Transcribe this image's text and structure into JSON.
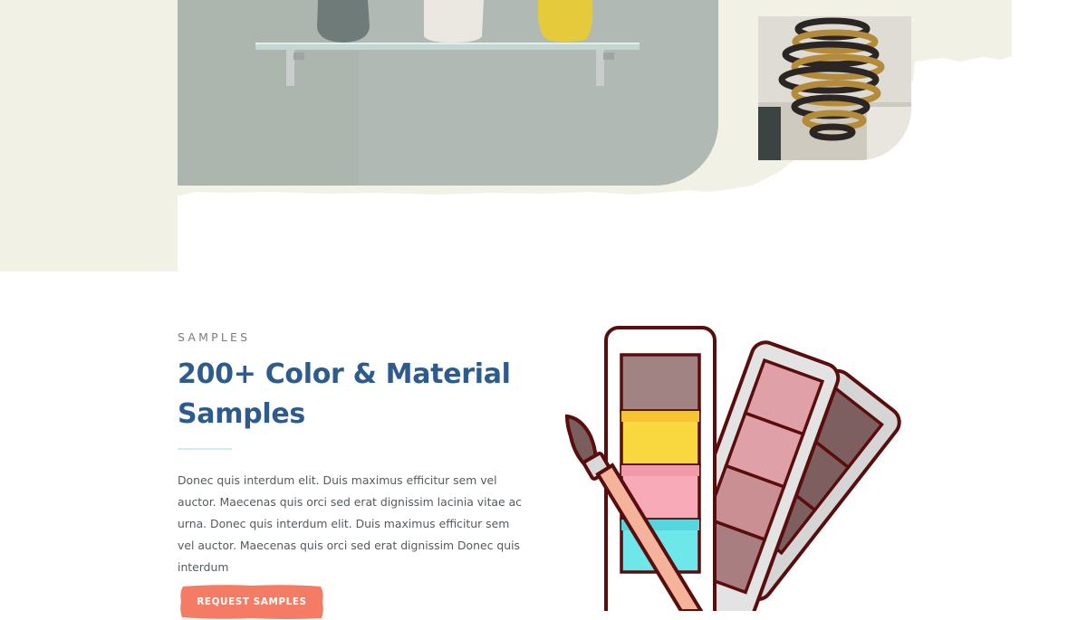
{
  "hero": {
    "photo_alt": "Glass shelf with vases",
    "chandelier_alt": "Spiral chandelier"
  },
  "samples": {
    "eyebrow": "SAMPLES",
    "heading": "200+ Color & Material Samples",
    "body": "Donec quis interdum elit. Duis maximus efficitur sem vel auctor. Maecenas quis orci sed erat dignissim lacinia vitae ac urna. Donec quis interdum elit. Duis maximus efficitur sem vel auctor. Maecenas quis orci sed erat dignissim Donec quis interdum",
    "cta_label": "REQUEST SAMPLES"
  },
  "colors": {
    "heading": "#2d5b8e",
    "cta": "#f47c64",
    "outline": "#5a0d0d"
  },
  "icons": {
    "swatch": "color-swatch-fan-icon",
    "brush": "paintbrush-icon"
  }
}
